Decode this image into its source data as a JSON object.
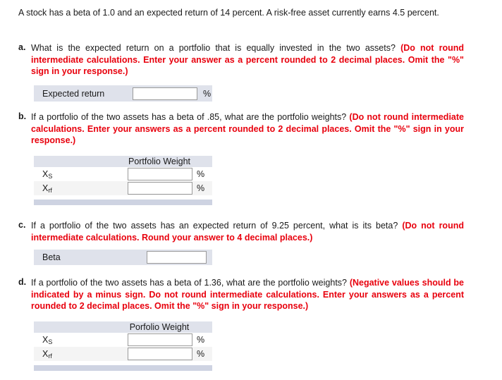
{
  "document": {
    "intro": "A stock has a beta of 1.0 and an expected return of 14 percent. A risk-free asset currently earns 4.5 percent."
  },
  "questions": {
    "a": {
      "marker": "a.",
      "prompt": "What is the expected return on a portfolio that is equally invested in the two assets?",
      "note": "(Do not round intermediate calculations. Enter your answer as a percent rounded to 2 decimal places. Omit the \"%\" sign in your response.)",
      "answer_label": "Expected return",
      "answer_value": "",
      "unit": "%"
    },
    "b": {
      "marker": "b.",
      "prompt": "If a portfolio of the two assets has a beta of .85, what are the portfolio weights?",
      "note": "(Do not round intermediate calculations. Enter your answers as a percent rounded to 2 decimal places. Omit the \"%\" sign in your response.)",
      "table": {
        "header": "Portfolio Weight",
        "rows": [
          {
            "label_base": "X",
            "label_sub": "S",
            "value": "",
            "unit": "%"
          },
          {
            "label_base": "X",
            "label_sub": "rf",
            "value": "",
            "unit": "%"
          }
        ]
      }
    },
    "c": {
      "marker": "c.",
      "prompt": "If a portfolio of the two assets has an expected return of 9.25 percent, what is its beta?",
      "note": "(Do not round intermediate calculations. Round your answer to 4 decimal places.)",
      "answer_label": "Beta",
      "answer_value": ""
    },
    "d": {
      "marker": "d.",
      "prompt": "If a portfolio of the two assets has a beta of 1.36, what are the portfolio weights?",
      "note": "(Negative values should be indicated by a minus sign. Do not round intermediate calculations. Enter your answers as a percent rounded to 2 decimal places. Omit the \"%\" sign in your response.)",
      "table": {
        "header": "Porfolio Weight",
        "rows": [
          {
            "label_base": "X",
            "label_sub": "S",
            "value": "",
            "unit": "%"
          },
          {
            "label_base": "X",
            "label_sub": "rf",
            "value": "",
            "unit": "%"
          }
        ]
      }
    }
  },
  "colors": {
    "note_red": "#e8000d",
    "row_bluegray": "#dfe2eb",
    "footer_bar": "#ced3e2",
    "alt_row": "#f4f4f4",
    "input_border": "#9a9a9a"
  }
}
